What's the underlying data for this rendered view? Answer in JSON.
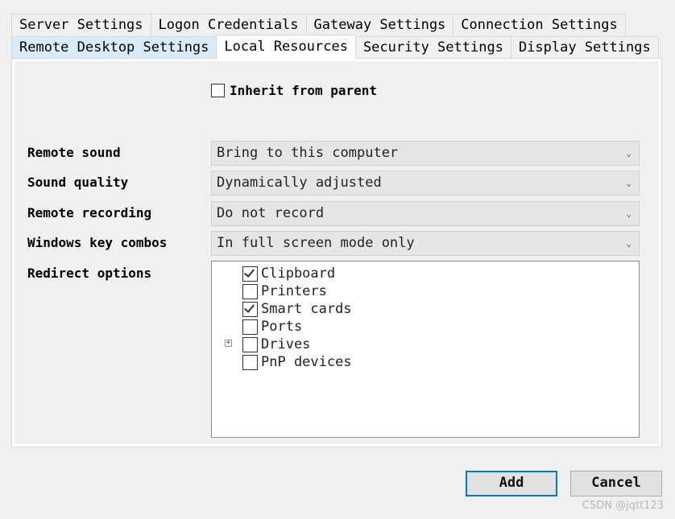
{
  "tabs": {
    "back_row": [
      {
        "label": "Server Settings"
      },
      {
        "label": "Logon Credentials"
      },
      {
        "label": "Gateway Settings"
      },
      {
        "label": "Connection Settings"
      }
    ],
    "front_row": [
      {
        "label": "Remote Desktop Settings"
      },
      {
        "label": "Local Resources",
        "active": true
      },
      {
        "label": "Security Settings"
      },
      {
        "label": "Display Settings"
      }
    ]
  },
  "inherit": {
    "label": "Inherit from parent",
    "checked": false
  },
  "fields": [
    {
      "label": "Remote sound",
      "value": "Bring to this computer"
    },
    {
      "label": "Sound quality",
      "value": "Dynamically adjusted"
    },
    {
      "label": "Remote recording",
      "value": "Do not record"
    },
    {
      "label": "Windows key combos",
      "value": "In full screen mode only"
    }
  ],
  "redirect": {
    "label": "Redirect options",
    "items": [
      {
        "label": "Clipboard",
        "checked": true
      },
      {
        "label": "Printers",
        "checked": false
      },
      {
        "label": "Smart cards",
        "checked": true
      },
      {
        "label": "Ports",
        "checked": false
      },
      {
        "label": "Drives",
        "checked": false,
        "expandable": true
      },
      {
        "label": "PnP devices",
        "checked": false
      }
    ]
  },
  "buttons": {
    "add": "Add",
    "cancel": "Cancel"
  },
  "watermark": "CSDN @jqtt123",
  "colors": {
    "active_tab_highlight": "#d9ebf9",
    "default_button_border": "#0078d7"
  }
}
